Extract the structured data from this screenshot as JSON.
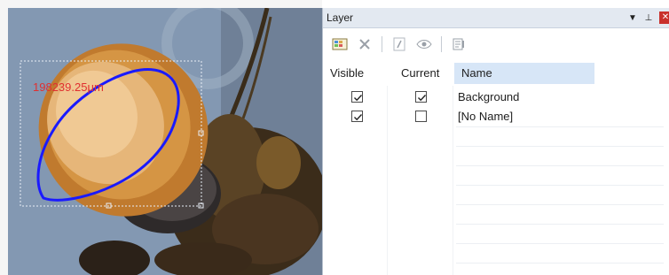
{
  "viewer": {
    "measurement_label": "198239.25μm",
    "overlay_color": "#1a1aff",
    "label_color": "#e03030"
  },
  "panel": {
    "title": "Layer",
    "controls": {
      "pin": "▼",
      "dock": "⊥",
      "close": "✕"
    },
    "toolbar": [
      {
        "name": "new-layer-icon"
      },
      {
        "name": "delete-layer-icon"
      },
      {
        "name": "edit-layer-icon"
      },
      {
        "name": "visibility-icon"
      },
      {
        "name": "layer-properties-icon"
      }
    ],
    "columns": {
      "visible": "Visible",
      "current": "Current",
      "name": "Name"
    },
    "rows": [
      {
        "visible": true,
        "current": true,
        "name": "Background"
      },
      {
        "visible": true,
        "current": false,
        "name": "[No Name]"
      }
    ]
  }
}
